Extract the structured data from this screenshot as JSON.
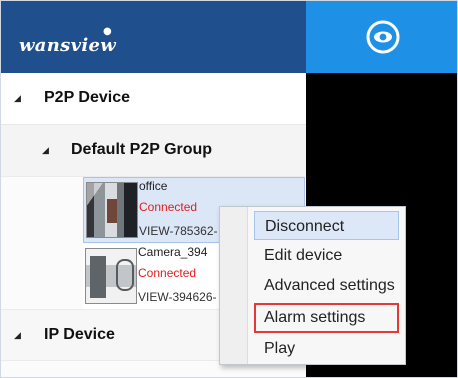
{
  "header": {
    "brand": "wansview",
    "view_button_icon": "eye-icon"
  },
  "tree": {
    "p2p_device": "P2P Device",
    "default_group": "Default P2P Group",
    "ip_device": "IP Device",
    "devices": [
      {
        "name": "office",
        "status": "Connected",
        "id": "VIEW-785362-"
      },
      {
        "name": "Camera_394",
        "status": "Connected",
        "id": "VIEW-394626-"
      }
    ]
  },
  "context_menu": {
    "items": [
      "Disconnect",
      "Edit device",
      "Advanced settings",
      "Alarm settings",
      "Play"
    ]
  },
  "colors": {
    "brand_bar": "#1f4f8c",
    "accent": "#1e90e5",
    "status_connected": "#e11d1d",
    "highlight_outline": "#e53935"
  }
}
